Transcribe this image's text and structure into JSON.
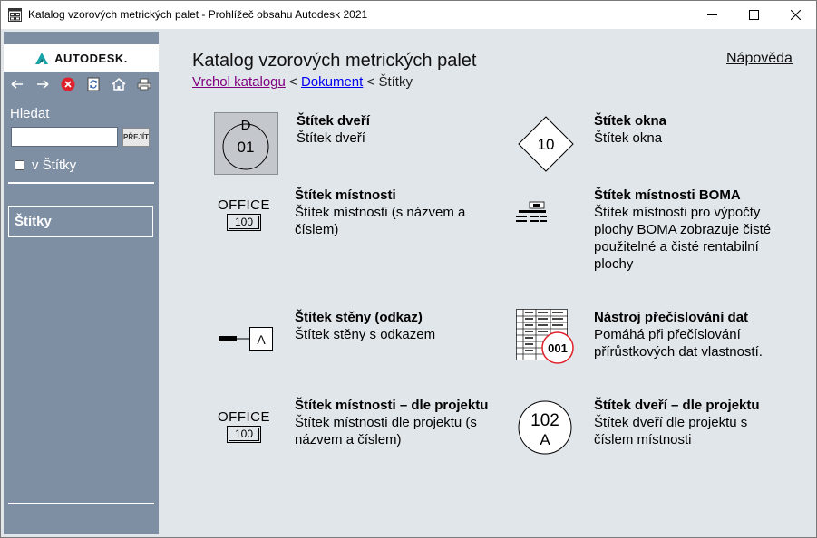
{
  "window": {
    "title": "Katalog vzorových metrických palet - Prohlížeč obsahu Autodesk 2021"
  },
  "sidebar": {
    "logo_text": "AUTODESK.",
    "toolbar": [
      "back-icon",
      "forward-icon",
      "stop-icon",
      "refresh-icon",
      "home-icon",
      "print-icon"
    ],
    "search_label": "Hledat",
    "search_value": "",
    "go_label": "PŘEJÍT",
    "scope_label": "v Štítky",
    "nav_items": [
      {
        "label": "Štítky"
      }
    ]
  },
  "main": {
    "title": "Katalog vzorových metrických palet",
    "help_label": "Nápověda",
    "breadcrumb": {
      "root": "Vrchol katalogu",
      "sep1": " < ",
      "middle": "Dokument",
      "sep2": " < ",
      "current": "Štítky"
    },
    "items": [
      {
        "name": "Štítek dveří",
        "desc": "Štítek dveří",
        "icon": "door-tag-icon"
      },
      {
        "name": "Štítek okna",
        "desc": "Štítek okna",
        "icon": "window-tag-icon"
      },
      {
        "name": "Štítek místnosti",
        "desc": "Štítek místnosti (s názvem a číslem)",
        "icon": "room-tag-icon",
        "icon_text": "OFFICE",
        "icon_num": "100"
      },
      {
        "name": "Štítek místnosti BOMA",
        "desc": "Štítek místnosti pro výpočty plochy BOMA zobrazuje čisté použitelné a čisté rentabilní plochy",
        "icon": "boma-room-tag-icon"
      },
      {
        "name": "Štítek stěny (odkaz)",
        "desc": "Štítek stěny s odkazem",
        "icon": "wall-tag-icon",
        "icon_text": "A"
      },
      {
        "name": "Nástroj přečíslování dat",
        "desc": "Pomáhá při přečíslování přírůstkových dat vlastností.",
        "icon": "renumber-data-icon",
        "icon_text": "001"
      },
      {
        "name": "Štítek místnosti – dle projektu",
        "desc": "Štítek místnosti dle projektu (s názvem a číslem)",
        "icon": "room-tag-project-icon",
        "icon_text": "OFFICE",
        "icon_num": "100"
      },
      {
        "name": "Štítek dveří – dle projektu",
        "desc": "Štítek dveří dle projektu s číslem místnosti",
        "icon": "door-tag-project-icon",
        "icon_text": "102",
        "icon_sub": "A"
      }
    ]
  },
  "colors": {
    "sidebar_bg": "#7e8ea3",
    "content_bg": "#e1e6ea",
    "link": "#0000ee",
    "visited_link": "#800080",
    "stop_red": "#e0202a",
    "autodesk_teal": "#18a3a9"
  }
}
